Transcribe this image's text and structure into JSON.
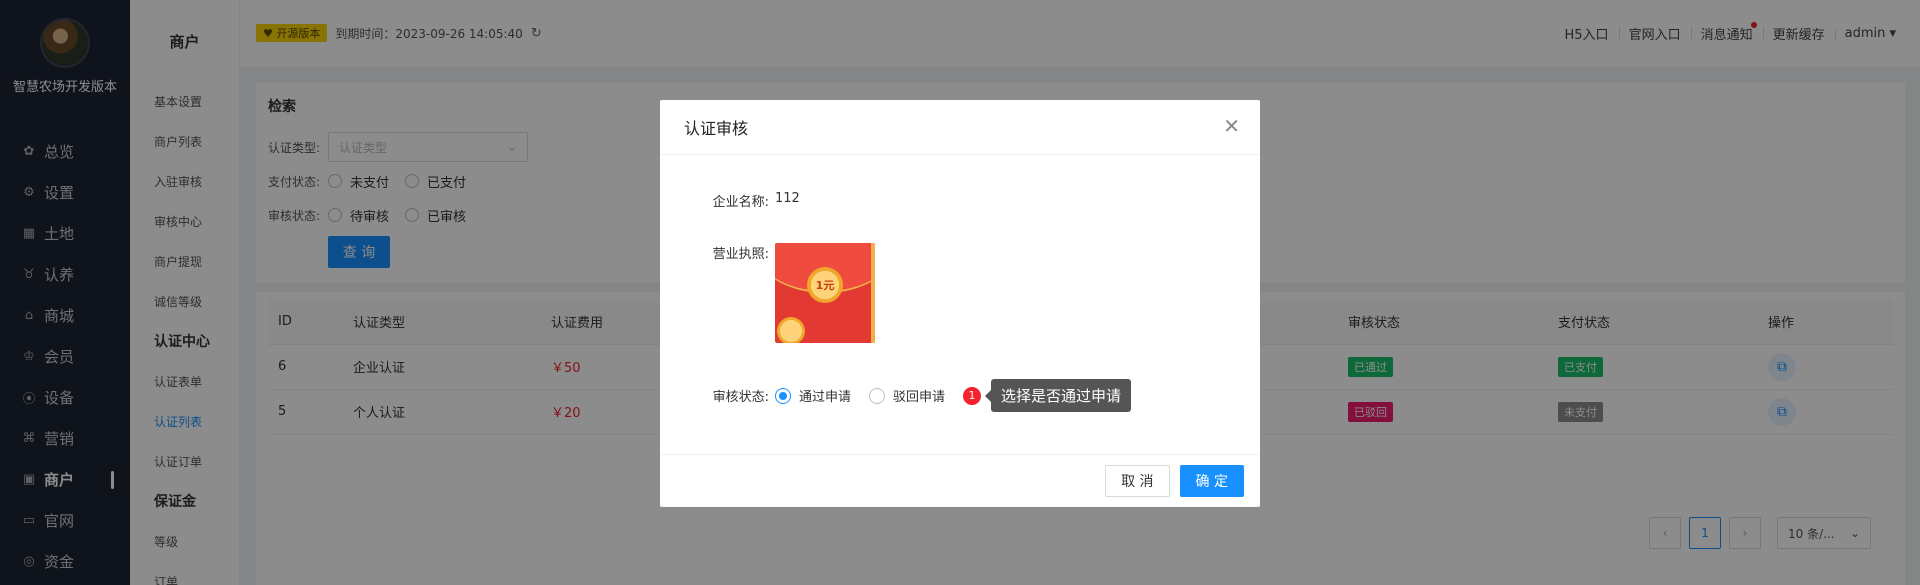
{
  "app": {
    "name": "智慧农场开发版本"
  },
  "nav": {
    "items": [
      {
        "label": "总览",
        "icon": "dashboard-icon",
        "glyph": "✿"
      },
      {
        "label": "设置",
        "icon": "gear-icon",
        "glyph": "⚙"
      },
      {
        "label": "土地",
        "icon": "grid-icon",
        "glyph": "▦"
      },
      {
        "label": "认养",
        "icon": "cow-icon",
        "glyph": "♉"
      },
      {
        "label": "商城",
        "icon": "home-icon",
        "glyph": "⌂"
      },
      {
        "label": "会员",
        "icon": "crown-icon",
        "glyph": "♔"
      },
      {
        "label": "设备",
        "icon": "location-icon",
        "glyph": "⦿"
      },
      {
        "label": "营销",
        "icon": "command-icon",
        "glyph": "⌘"
      },
      {
        "label": "商户",
        "icon": "store-icon",
        "glyph": "▣",
        "active": true
      },
      {
        "label": "官网",
        "icon": "browser-icon",
        "glyph": "▭"
      },
      {
        "label": "资金",
        "icon": "coin-icon",
        "glyph": "◎"
      }
    ]
  },
  "subnav": {
    "title": "商户",
    "items": [
      {
        "label": "基本设置"
      },
      {
        "label": "商户列表"
      },
      {
        "label": "入驻审核"
      },
      {
        "label": "审核中心"
      },
      {
        "label": "商户提现"
      },
      {
        "label": "诚信等级"
      },
      {
        "label": "认证中心",
        "group": true
      },
      {
        "label": "认证表单"
      },
      {
        "label": "认证列表",
        "active": true
      },
      {
        "label": "认证订单"
      },
      {
        "label": "保证金",
        "group": true
      },
      {
        "label": "等级"
      },
      {
        "label": "订单"
      }
    ]
  },
  "header": {
    "badge": "♥ 开源版本",
    "expire": "到期时间：2023-09-26 14:05:40",
    "links": {
      "h5": "H5入口",
      "site": "官网入口",
      "msg": "消息通知",
      "cache": "更新缓存",
      "user": "admin ▾"
    }
  },
  "search": {
    "title": "检索",
    "type_label": "认证类型:",
    "type_placeholder": "认证类型",
    "pay_label": "支付状态:",
    "pay_opts": [
      "未支付",
      "已支付"
    ],
    "audit_label": "审核状态:",
    "audit_opts": [
      "待审核",
      "已审核"
    ],
    "query_btn": "查 询"
  },
  "table": {
    "headers": {
      "id": "ID",
      "type": "认证类型",
      "fee": "认证费用",
      "audit": "审核状态",
      "pay": "支付状态",
      "op": "操作"
    },
    "rows": [
      {
        "id": "6",
        "type": "企业认证",
        "fee": "￥50",
        "audit": "已通过",
        "audit_color": "#19be6b",
        "pay": "已支付",
        "pay_color": "#19be6b"
      },
      {
        "id": "5",
        "type": "个人认证",
        "fee": "￥20",
        "audit": "已驳回",
        "audit_color": "#ed1c6f",
        "pay": "未支付",
        "pay_color": "#8c8c8c"
      }
    ],
    "page": "1",
    "page_size": "10 条/..."
  },
  "modal": {
    "title": "认证审核",
    "company_label": "企业名称:",
    "company_value": "112",
    "license_label": "营业执照:",
    "coin_text": "1元",
    "status_label": "审核状态:",
    "opt_pass": "通过申请",
    "opt_reject": "驳回申请",
    "step": "1",
    "tip": "选择是否通过申请",
    "cancel": "取 消",
    "ok": "确 定"
  }
}
